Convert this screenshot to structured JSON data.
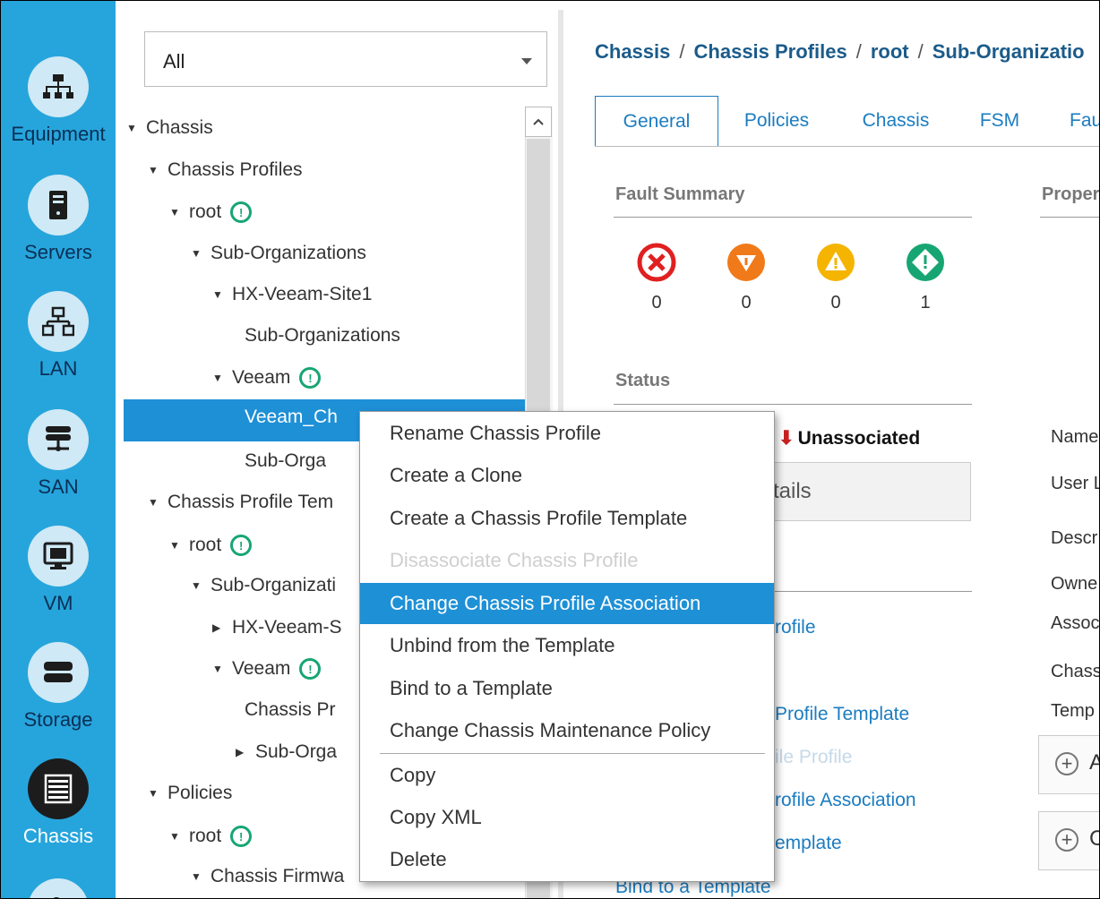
{
  "rail": {
    "items": [
      {
        "label": "Equipment",
        "icon": "equipment-icon"
      },
      {
        "label": "Servers",
        "icon": "server-icon"
      },
      {
        "label": "LAN",
        "icon": "lan-icon"
      },
      {
        "label": "SAN",
        "icon": "san-icon"
      },
      {
        "label": "VM",
        "icon": "vm-icon"
      },
      {
        "label": "Storage",
        "icon": "storage-icon"
      },
      {
        "label": "Chassis",
        "icon": "chassis-icon",
        "active": true
      }
    ]
  },
  "filter": {
    "value": "All"
  },
  "tree": [
    {
      "label": "Chassis",
      "toggle": "expanded"
    },
    {
      "label": "Chassis Profiles",
      "toggle": "expanded"
    },
    {
      "label": "root",
      "toggle": "expanded",
      "badge": true
    },
    {
      "label": "Sub-Organizations",
      "toggle": "expanded"
    },
    {
      "label": "HX-Veeam-Site1",
      "toggle": "expanded"
    },
    {
      "label": "Sub-Organizations",
      "toggle": "none"
    },
    {
      "label": "Veeam",
      "toggle": "expanded",
      "badge": true
    },
    {
      "label": "Veeam_Ch",
      "toggle": "none",
      "selected": true
    },
    {
      "label": "Sub-Orga",
      "toggle": "none"
    },
    {
      "label": "Chassis Profile Tem",
      "toggle": "expanded"
    },
    {
      "label": "root",
      "toggle": "expanded",
      "badge": true
    },
    {
      "label": "Sub-Organizati",
      "toggle": "expanded"
    },
    {
      "label": "HX-Veeam-S",
      "toggle": "collapsed"
    },
    {
      "label": "Veeam",
      "toggle": "expanded",
      "badge": true
    },
    {
      "label": "Chassis Pr",
      "toggle": "none"
    },
    {
      "label": "Sub-Orga",
      "toggle": "collapsed"
    },
    {
      "label": "Policies",
      "toggle": "expanded"
    },
    {
      "label": "root",
      "toggle": "expanded",
      "badge": true
    },
    {
      "label": "Chassis Firmwa",
      "toggle": "expanded"
    }
  ],
  "breadcrumb": [
    "Chassis",
    "Chassis Profiles",
    "root",
    "Sub-Organizatio"
  ],
  "tabs": [
    "General",
    "Policies",
    "Chassis",
    "FSM",
    "Fau"
  ],
  "fault_summary": {
    "title": "Fault Summary",
    "counts": [
      {
        "severity": "critical",
        "count": "0",
        "color": "#e02020"
      },
      {
        "severity": "major",
        "count": "0",
        "color": "#f07a1a"
      },
      {
        "severity": "minor",
        "count": "0",
        "color": "#f4b400"
      },
      {
        "severity": "warning",
        "count": "1",
        "color": "#17a673"
      }
    ]
  },
  "properties": {
    "title": "Proper",
    "labels": [
      "Name",
      "User L",
      "Descr",
      "Owne",
      "Assoc",
      "Chass",
      "Temp"
    ],
    "add_buttons": [
      "A",
      "C"
    ]
  },
  "status": {
    "title": "Status",
    "value": "Unassociated",
    "details_label": "tails"
  },
  "actions": [
    "rofile",
    "Profile Template",
    "ile Profile",
    "rofile Association",
    "emplate",
    "Bind to a Template"
  ],
  "context_menu": {
    "items": [
      {
        "label": "Rename Chassis Profile"
      },
      {
        "label": "Create a Clone"
      },
      {
        "label": "Create a Chassis Profile Template"
      },
      {
        "label": "Disassociate Chassis Profile",
        "disabled": true
      },
      {
        "label": "Change Chassis Profile Association",
        "highlighted": true
      },
      {
        "label": "Unbind from the Template"
      },
      {
        "label": "Bind to a Template"
      },
      {
        "label": "Change Chassis Maintenance Policy"
      },
      {
        "label": "Copy"
      },
      {
        "label": "Copy XML"
      },
      {
        "label": "Delete"
      }
    ]
  },
  "colors": {
    "rail": "#26a5dc",
    "accent": "#1e90d6",
    "link": "#1b7cc0",
    "ok": "#17a673",
    "critical": "#e02020",
    "major": "#f07a1a",
    "minor": "#f4b400"
  }
}
